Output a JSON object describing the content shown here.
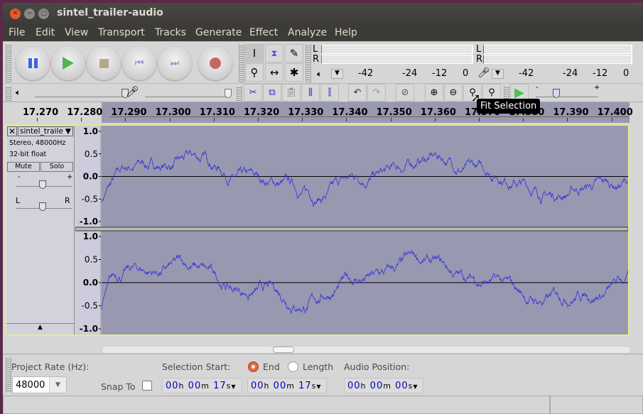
{
  "window": {
    "title": "sintel_trailer-audio"
  },
  "menu": [
    "File",
    "Edit",
    "View",
    "Transport",
    "Tracks",
    "Generate",
    "Effect",
    "Analyze",
    "Help"
  ],
  "transport": {
    "buttons": [
      "pause",
      "play",
      "stop",
      "skip-to-start",
      "skip-to-end",
      "record"
    ]
  },
  "tools": [
    "selection",
    "envelope",
    "draw",
    "zoom",
    "time-shift",
    "multi"
  ],
  "meters": {
    "play": {
      "channels": [
        "L",
        "R"
      ],
      "scale": [
        "-42",
        "-24",
        "-12",
        "0"
      ]
    },
    "record": {
      "channels": [
        "L",
        "R"
      ],
      "scale": [
        "-42",
        "-24",
        "-12",
        "0"
      ]
    }
  },
  "mixer": {
    "minus": "-",
    "plus": "+"
  },
  "speed": {
    "minus": "-",
    "plus": "+"
  },
  "tooltip": "Fit Selection",
  "ruler": [
    "17.270",
    "17.280",
    "17.290",
    "17.300",
    "17.310",
    "17.320",
    "17.330",
    "17.340",
    "17.350",
    "17.360",
    "17.370",
    "17.380",
    "17.390",
    "17.400"
  ],
  "track": {
    "name": "sintel_traile",
    "info1": "Stereo, 48000Hz",
    "info2": "32-bit float",
    "mute": "Mute",
    "solo": "Solo",
    "gain_minus": "-",
    "gain_plus": "+",
    "pan_left": "L",
    "pan_right": "R",
    "scale": [
      "1.0",
      "0.5",
      "0.0",
      "-0.5",
      "-1.0"
    ]
  },
  "colors": {
    "waveform": "#3232dc",
    "selection_bg": "#9898b0",
    "track_border": "#e8e890",
    "record": "#c86464",
    "play": "#50b450",
    "pause": "#3c64dc"
  },
  "selection_bar": {
    "project_rate_label": "Project Rate (Hz):",
    "project_rate": "48000",
    "snap_label": "Snap To",
    "snap_checked": false,
    "selection_start_label": "Selection Start:",
    "end_label": "End",
    "length_label": "Length",
    "end_selected": true,
    "audio_position_label": "Audio Position:",
    "start": {
      "h": "00",
      "m": "00",
      "s": "17"
    },
    "end": {
      "h": "00",
      "m": "00",
      "s": "17"
    },
    "position": {
      "h": "00",
      "m": "00",
      "s": "00"
    },
    "h": "h",
    "m": "m",
    "s": "s"
  },
  "status": ""
}
